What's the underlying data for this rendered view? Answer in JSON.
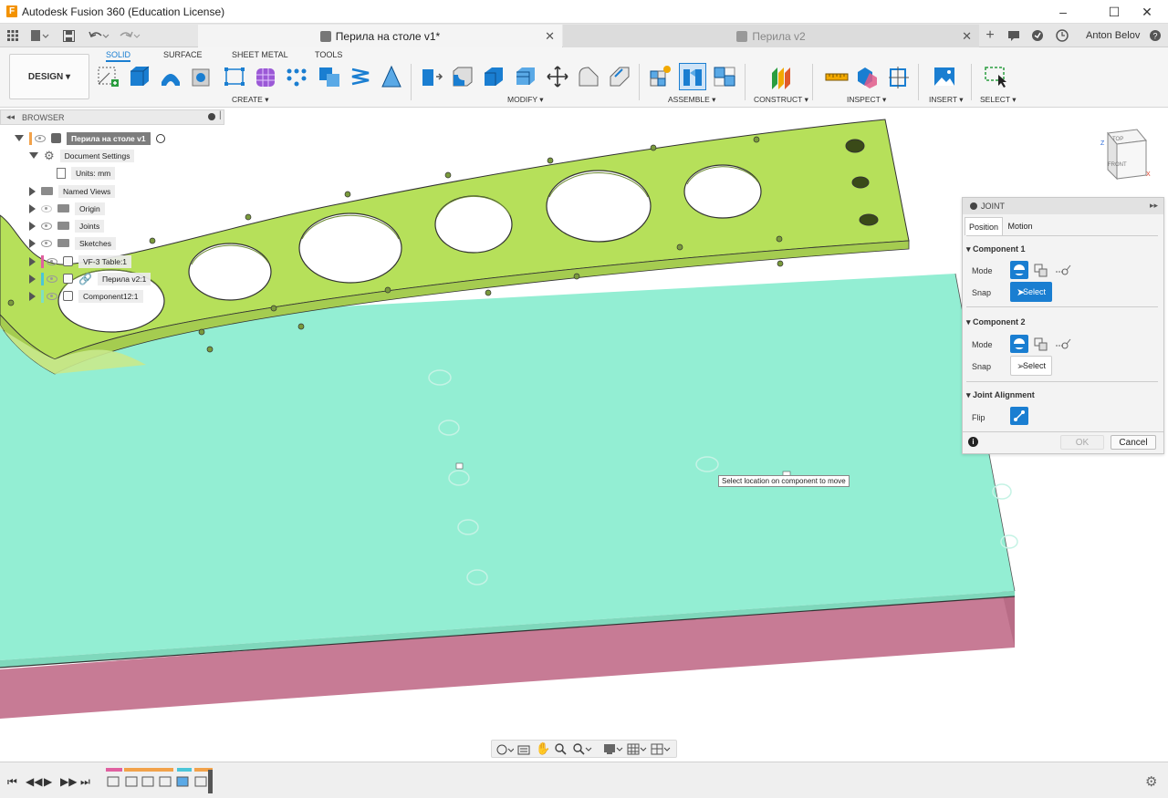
{
  "window": {
    "title": "Autodesk Fusion 360 (Education License)",
    "app_icon_letter": "F",
    "minimize": "–",
    "maximize": "☐",
    "close": "✕"
  },
  "tabs": [
    {
      "label": "Перила на столе v1*",
      "close": "✕",
      "active": true
    },
    {
      "label": "Перила v2",
      "close": "✕",
      "active": false
    }
  ],
  "user": {
    "name": "Anton Belov"
  },
  "ribbon": {
    "workspace": "DESIGN ▾",
    "tabs": [
      "SOLID",
      "SURFACE",
      "SHEET METAL",
      "TOOLS"
    ],
    "groups": [
      "CREATE ▾",
      "MODIFY ▾",
      "ASSEMBLE ▾",
      "CONSTRUCT ▾",
      "INSPECT ▾",
      "INSERT ▾",
      "SELECT ▾"
    ]
  },
  "browser": {
    "header": "BROWSER",
    "items": [
      {
        "label": "Перила на столе v1"
      },
      {
        "label": "Document Settings"
      },
      {
        "label": "Units: mm"
      },
      {
        "label": "Named Views"
      },
      {
        "label": "Origin"
      },
      {
        "label": "Joints"
      },
      {
        "label": "Sketches"
      },
      {
        "label": "VF-3 Table:1"
      },
      {
        "label": "Перила v2:1"
      },
      {
        "label": "Component12:1"
      }
    ]
  },
  "viewcube": {
    "top": "TOP",
    "front": "FRONT",
    "x": "X",
    "z": "Z"
  },
  "joint": {
    "title": "JOINT",
    "tabs": [
      "Position",
      "Motion"
    ],
    "component1": {
      "title": "Component 1",
      "mode_label": "Mode",
      "snap_label": "Snap",
      "select": "Select"
    },
    "component2": {
      "title": "Component 2",
      "mode_label": "Mode",
      "snap_label": "Snap",
      "select": "Select"
    },
    "alignment": {
      "title": "Joint Alignment",
      "flip_label": "Flip"
    },
    "ok": "OK",
    "cancel": "Cancel",
    "info": "i"
  },
  "tooltip": "Select location on component to move",
  "colors": {
    "accent": "#1a7ed1",
    "rail_green": "#b6e05a",
    "table_top": "#93eed3",
    "table_side": "#c77b95"
  }
}
